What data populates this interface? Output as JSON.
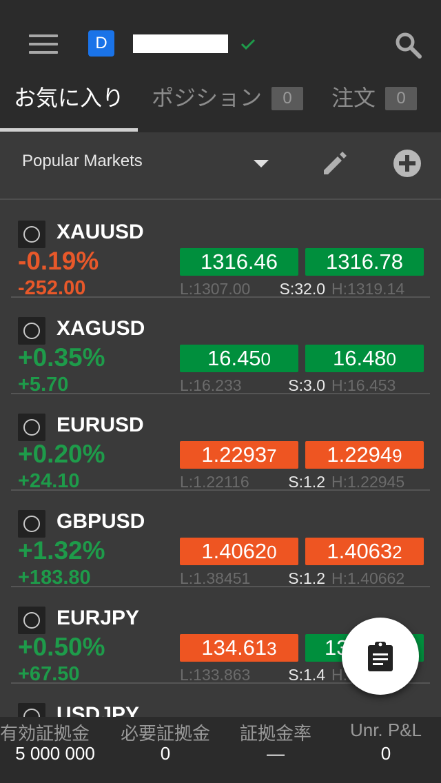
{
  "header": {
    "account_badge": "D",
    "tabs": [
      {
        "label": "お気に入り"
      },
      {
        "label": "ポジション",
        "count": "0"
      },
      {
        "label": "注文",
        "count": "0"
      }
    ]
  },
  "filter": {
    "label": "Popular Markets"
  },
  "markets": [
    {
      "symbol": "XAUUSD",
      "pct": "-0.19%",
      "change": "-252.00",
      "bid": "1316.46",
      "ask": "1316.78",
      "low": "L:1307.00",
      "spread": "S:32.0",
      "high": "H:1319.14"
    },
    {
      "symbol": "XAGUSD",
      "pct": "+0.35%",
      "change": "+5.70",
      "bid_main": "16.45",
      "bid_pip": "0",
      "ask_main": "16.48",
      "ask_pip": "0",
      "low": "L:16.233",
      "spread": "S:3.0",
      "high": "H:16.453"
    },
    {
      "symbol": "EURUSD",
      "pct": "+0.20%",
      "change": "+24.10",
      "bid_main": "1.2293",
      "bid_pip": "7",
      "ask_main": "1.2294",
      "ask_pip": "9",
      "low": "L:1.22116",
      "spread": "S:1.2",
      "high": "H:1.22945"
    },
    {
      "symbol": "GBPUSD",
      "pct": "+1.32%",
      "change": "+183.80",
      "bid_main": "1.4062",
      "bid_pip": "0",
      "ask_main": "1.4063",
      "ask_pip": "2",
      "low": "L:1.38451",
      "spread": "S:1.2",
      "high": "H:1.40662"
    },
    {
      "symbol": "EURJPY",
      "pct": "+0.50%",
      "change": "+67.50",
      "bid_main": "134.61",
      "bid_pip": "3",
      "ask_main": "13",
      "low": "L:133.863",
      "spread": "S:1.4",
      "high": "H."
    },
    {
      "symbol": "USDJPY"
    }
  ],
  "footer": [
    {
      "label": "有効証拠金",
      "value": "5 000 000"
    },
    {
      "label": "必要証拠金",
      "value": "0"
    },
    {
      "label": "証拠金率",
      "value": "—"
    },
    {
      "label": "Unr. P&L",
      "value": "0"
    }
  ],
  "colors": {
    "up": "#1e9b4a",
    "down": "#e8582a",
    "price_up": "#008f3d",
    "price_down": "#ee5522",
    "badge": "#1a73e8"
  },
  "icons": [
    "menu-icon",
    "check-icon",
    "search-icon",
    "dropdown-icon",
    "edit-icon",
    "add-icon",
    "circle-icon",
    "clipboard-icon"
  ]
}
